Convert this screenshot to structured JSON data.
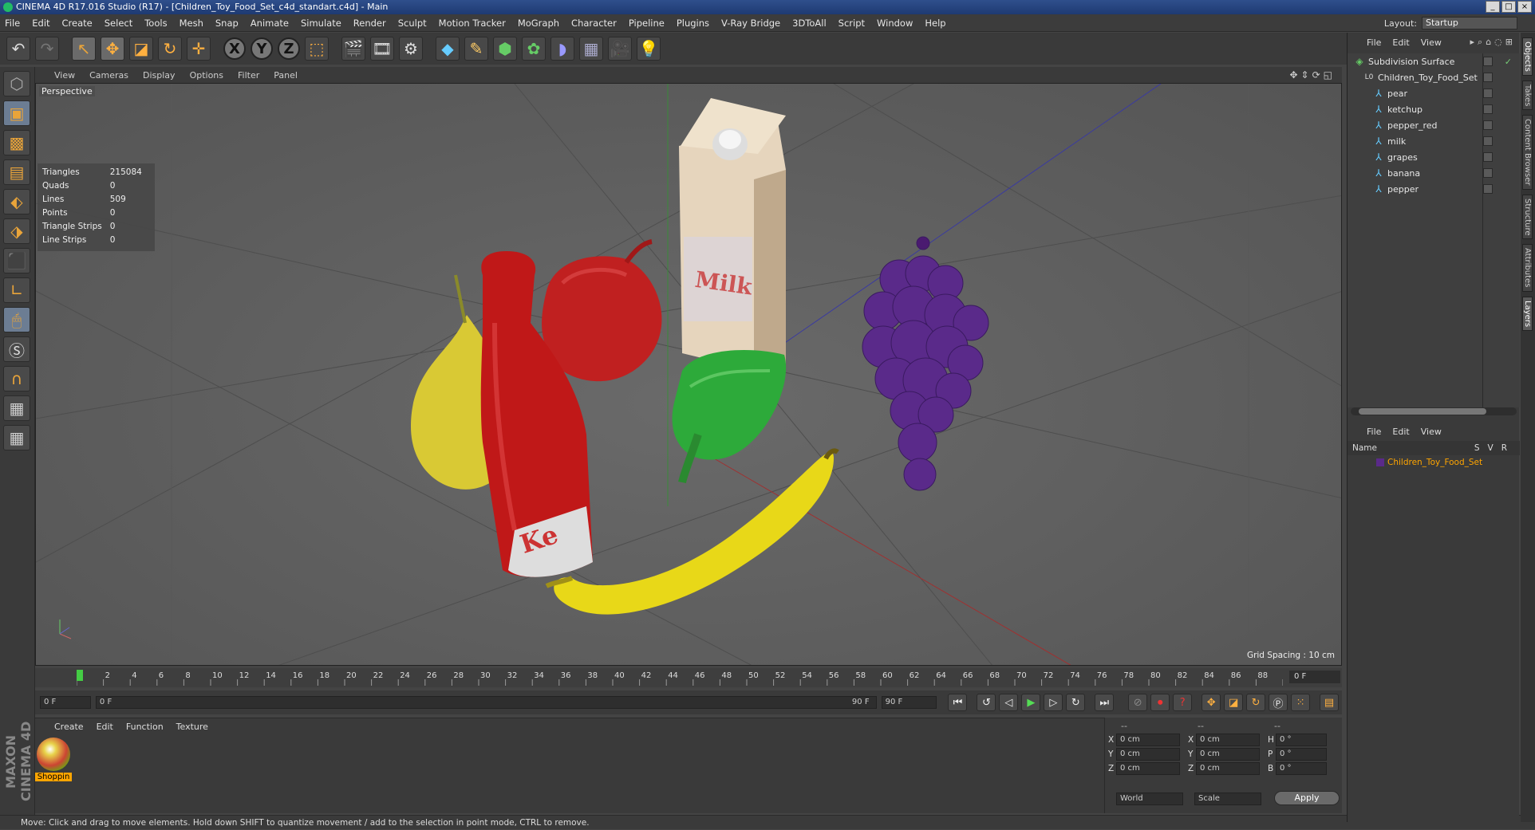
{
  "window": {
    "title": "CINEMA 4D R17.016 Studio (R17) - [Children_Toy_Food_Set_c4d_standart.c4d] - Main"
  },
  "menubar": {
    "items": [
      "File",
      "Edit",
      "Create",
      "Select",
      "Tools",
      "Mesh",
      "Snap",
      "Animate",
      "Simulate",
      "Render",
      "Sculpt",
      "Motion Tracker",
      "MoGraph",
      "Character",
      "Pipeline",
      "Plugins",
      "V-Ray Bridge",
      "3DToAll",
      "Script",
      "Window",
      "Help"
    ]
  },
  "layout": {
    "label": "Layout:",
    "value": "Startup"
  },
  "toolbar": {
    "x_axis": "X",
    "y_axis": "Y",
    "z_axis": "Z"
  },
  "viewport": {
    "menu": [
      "View",
      "Cameras",
      "Display",
      "Options",
      "Filter",
      "Panel"
    ],
    "label": "Perspective",
    "stats": [
      {
        "k": "Triangles",
        "v": "215084"
      },
      {
        "k": "Quads",
        "v": "0"
      },
      {
        "k": "Lines",
        "v": "509"
      },
      {
        "k": "Points",
        "v": "0"
      },
      {
        "k": "Triangle Strips",
        "v": "0"
      },
      {
        "k": "Line Strips",
        "v": "0"
      }
    ],
    "grid_spacing": "Grid Spacing : 10 cm",
    "milk_label": "Milk",
    "ketchup_label": "Ke"
  },
  "timeline": {
    "ticks": [
      "0",
      "2",
      "4",
      "6",
      "8",
      "10",
      "12",
      "14",
      "16",
      "18",
      "20",
      "22",
      "24",
      "26",
      "28",
      "30",
      "32",
      "34",
      "36",
      "38",
      "40",
      "42",
      "44",
      "46",
      "48",
      "50",
      "52",
      "54",
      "56",
      "58",
      "60",
      "62",
      "64",
      "66",
      "68",
      "70",
      "72",
      "74",
      "76",
      "78",
      "80",
      "82",
      "84",
      "86",
      "88",
      "90"
    ],
    "current_frame": "0 F"
  },
  "controls": {
    "start": "0 F",
    "range_start": "0 F",
    "range_end": "90 F",
    "end": "90 F"
  },
  "material_panel": {
    "menu": [
      "Create",
      "Edit",
      "Function",
      "Texture"
    ],
    "material_name": "Shoppin"
  },
  "coords": {
    "headers": [
      "--",
      "--",
      "--"
    ],
    "rows": [
      {
        "a": "X",
        "av": "0 cm",
        "b": "X",
        "bv": "0 cm",
        "c": "H",
        "cv": "0 °"
      },
      {
        "a": "Y",
        "av": "0 cm",
        "b": "Y",
        "bv": "0 cm",
        "c": "P",
        "cv": "0 °"
      },
      {
        "a": "Z",
        "av": "0 cm",
        "b": "Z",
        "bv": "0 cm",
        "c": "B",
        "cv": "0 °"
      }
    ],
    "world": "World",
    "scale": "Scale",
    "apply": "Apply"
  },
  "objects_panel": {
    "menu": [
      "File",
      "Edit",
      "View"
    ],
    "items": [
      {
        "name": "Subdivision Surface",
        "level": 0
      },
      {
        "name": "Children_Toy_Food_Set",
        "level": 1
      },
      {
        "name": "pear",
        "level": 2
      },
      {
        "name": "ketchup",
        "level": 2
      },
      {
        "name": "pepper_red",
        "level": 2
      },
      {
        "name": "milk",
        "level": 2
      },
      {
        "name": "grapes",
        "level": 2
      },
      {
        "name": "banana",
        "level": 2
      },
      {
        "name": "pepper",
        "level": 2
      }
    ]
  },
  "layers_panel": {
    "menu": [
      "File",
      "Edit",
      "View"
    ],
    "col_name": "Name",
    "col_flags": "SVR",
    "layer": "Children_Toy_Food_Set"
  },
  "side_tabs": [
    "Objects",
    "Takes",
    "Content Browser",
    "Structure",
    "Attributes",
    "Layers"
  ],
  "status": "Move: Click and drag to move elements. Hold down SHIFT to quantize movement / add to the selection in point mode, CTRL to remove.",
  "logo": "MAXON CINEMA 4D"
}
